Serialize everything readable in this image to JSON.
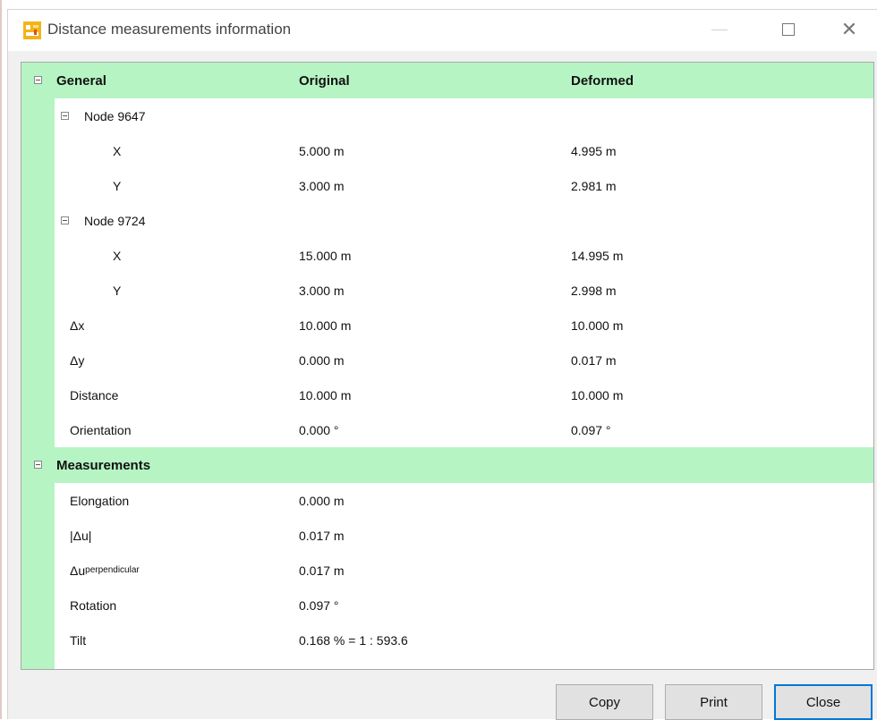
{
  "window": {
    "title": "Distance measurements information"
  },
  "header": {
    "col1": "General",
    "col2": "Original",
    "col3": "Deformed"
  },
  "node1": {
    "label": "Node 9647",
    "x": {
      "label": "X",
      "original": "5.000 m",
      "deformed": "4.995 m"
    },
    "y": {
      "label": "Y",
      "original": "3.000 m",
      "deformed": "2.981 m"
    }
  },
  "node2": {
    "label": "Node 9724",
    "x": {
      "label": "X",
      "original": "15.000 m",
      "deformed": "14.995 m"
    },
    "y": {
      "label": "Y",
      "original": "3.000 m",
      "deformed": "2.998 m"
    }
  },
  "general": {
    "dx": {
      "label": "Δx",
      "original": "10.000 m",
      "deformed": "10.000 m"
    },
    "dy": {
      "label": "Δy",
      "original": "0.000 m",
      "deformed": "0.017 m"
    },
    "distance": {
      "label": "Distance",
      "original": "10.000 m",
      "deformed": "10.000 m"
    },
    "orientation": {
      "label": "Orientation",
      "original": "0.000 °",
      "deformed": "0.097 °"
    }
  },
  "measurements": {
    "title": "Measurements",
    "elongation": {
      "label": "Elongation",
      "value": "0.000 m"
    },
    "abs_du": {
      "label": "|Δu|",
      "value": "0.017 m"
    },
    "du_perp": {
      "label": "Δu",
      "sub": "perpendicular",
      "value": "0.017 m"
    },
    "rotation": {
      "label": "Rotation",
      "value": "0.097 °"
    },
    "tilt": {
      "label": "Tilt",
      "value": "0.168 % = 1 : 593.6"
    }
  },
  "buttons": {
    "copy": "Copy",
    "print": "Print",
    "close": "Close"
  },
  "colors": {
    "group_bg": "#b6f5c3",
    "accent": "#0078d7",
    "app_icon": "#f5b31a"
  }
}
